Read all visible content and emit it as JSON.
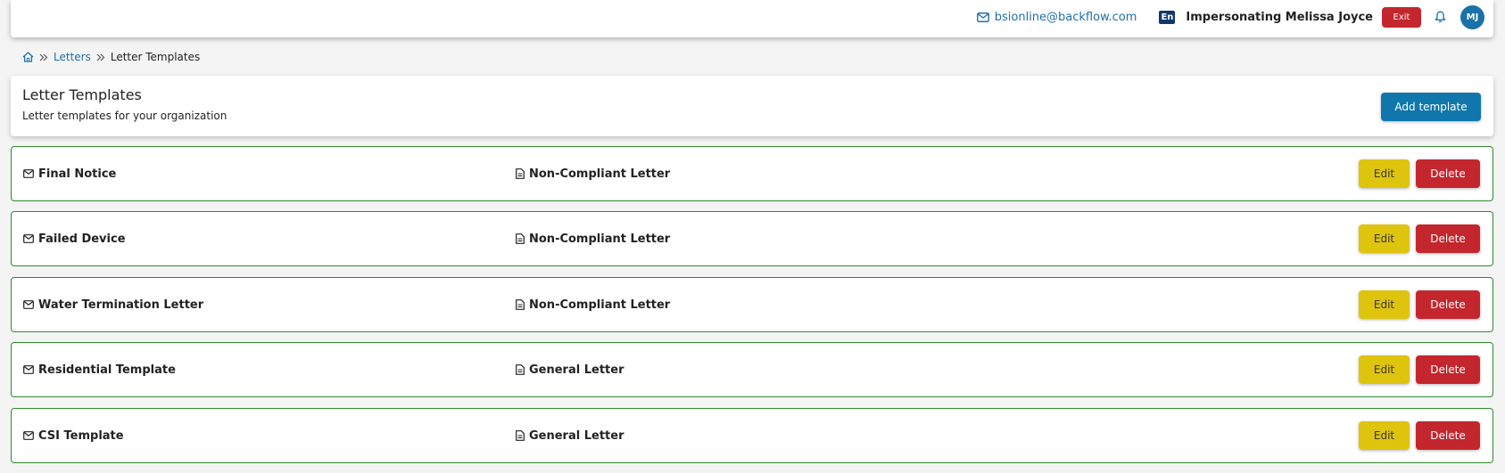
{
  "topbar": {
    "email": "bsionline@backflow.com",
    "language": "En",
    "impersonating_text": "Impersonating Melissa Joyce",
    "exit_label": "Exit",
    "avatar_initials": "MJ"
  },
  "breadcrumb": {
    "items": [
      "Letters",
      "Letter Templates"
    ]
  },
  "header": {
    "title": "Letter Templates",
    "subtitle": "Letter templates for your organization",
    "add_label": "Add template"
  },
  "templates": [
    {
      "name": "Final Notice",
      "type": "Non-Compliant Letter",
      "edit_label": "Edit",
      "delete_label": "Delete"
    },
    {
      "name": "Failed Device",
      "type": "Non-Compliant Letter",
      "edit_label": "Edit",
      "delete_label": "Delete"
    },
    {
      "name": "Water Termination Letter",
      "type": "Non-Compliant Letter",
      "edit_label": "Edit",
      "delete_label": "Delete"
    },
    {
      "name": "Residential Template",
      "type": "General Letter",
      "edit_label": "Edit",
      "delete_label": "Delete"
    },
    {
      "name": "CSI Template",
      "type": "General Letter",
      "edit_label": "Edit",
      "delete_label": "Delete"
    }
  ],
  "colors": {
    "primary": "#1077ad",
    "danger": "#c4262e",
    "warning": "#dfc40d",
    "success_border": "#2e8b2e",
    "link": "#1f6fa6"
  },
  "icons": {
    "home": "home-icon",
    "breadcrumb_separator": "chevrons-right-icon",
    "email": "envelope-icon",
    "document": "document-icon",
    "bell": "bell-icon"
  }
}
